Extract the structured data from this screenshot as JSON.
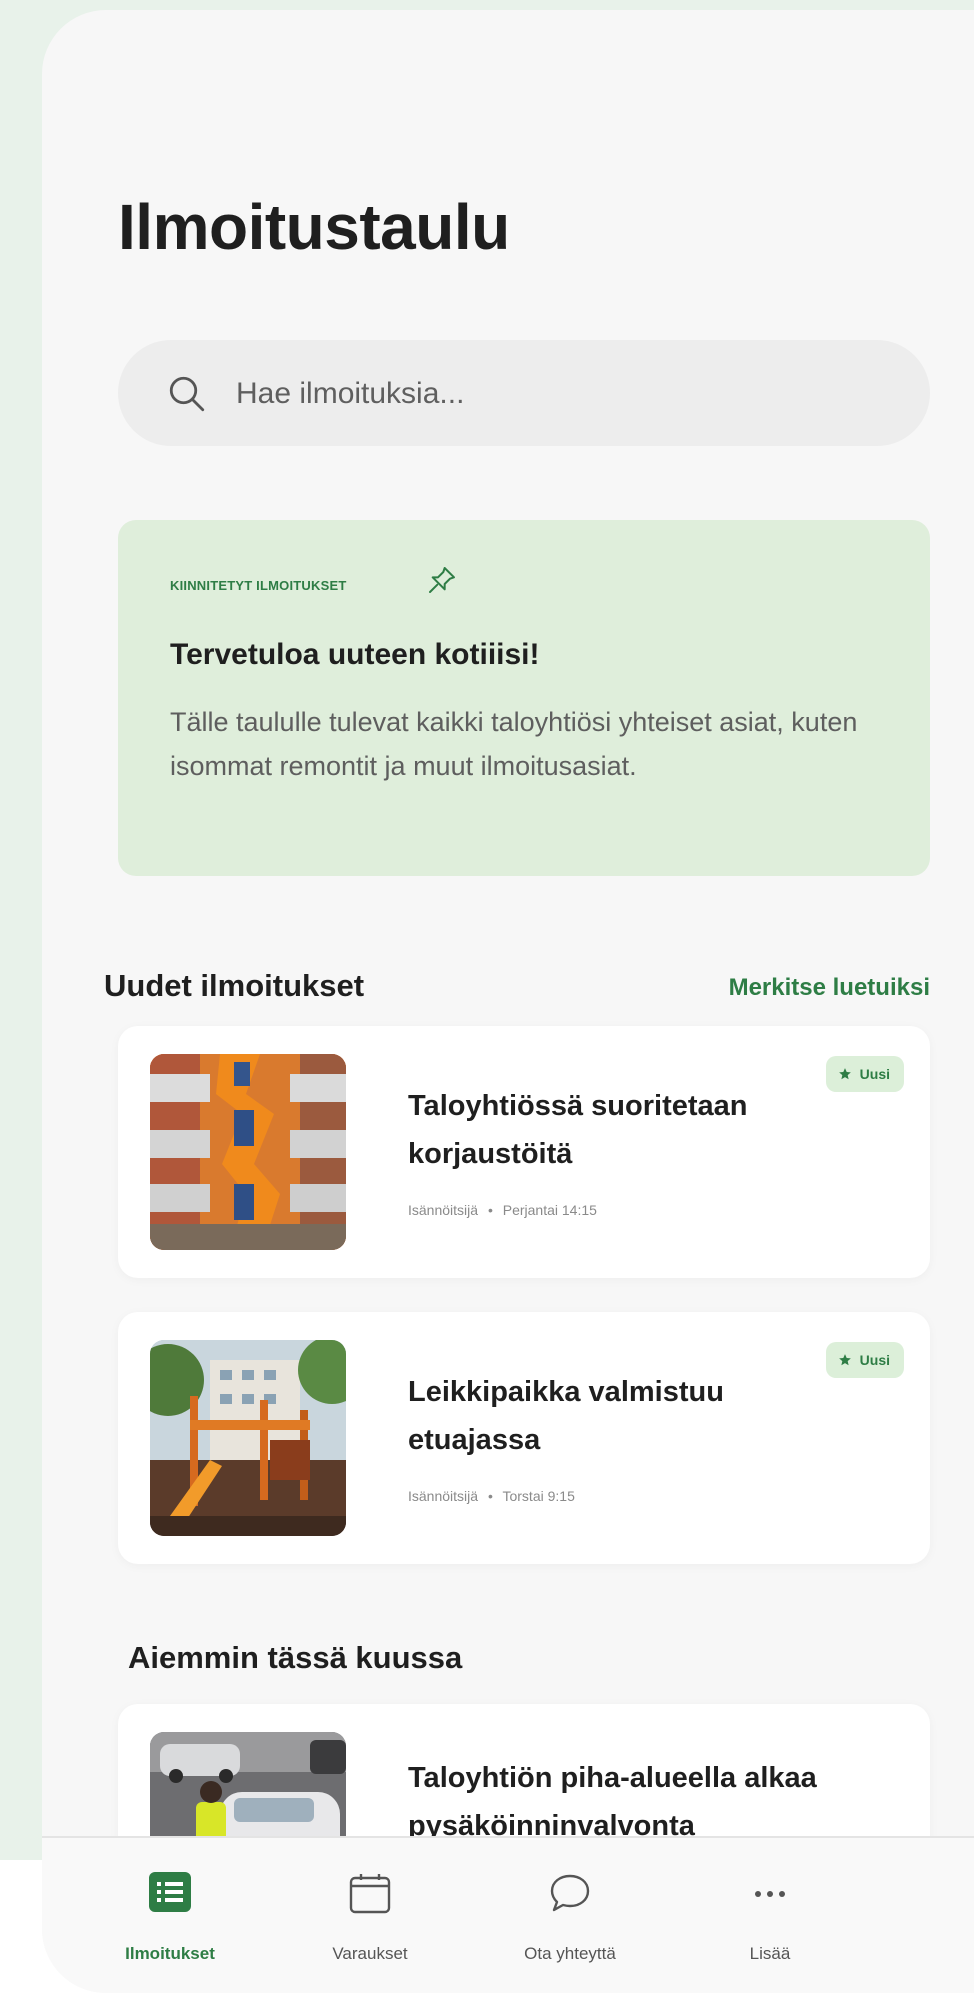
{
  "page": {
    "title": "Ilmoitustaulu"
  },
  "search": {
    "placeholder": "Hae ilmoituksia..."
  },
  "pinned": {
    "label": "KIINNITETYT ILMOITUKSET",
    "title": "Tervetuloa uuteen kotiiisi!",
    "body": "Tälle taululle tulevat kaikki taloyhtiösi yhteiset asiat, kuten isommat remontit ja muut ilmoitusasiat."
  },
  "new_section": {
    "heading": "Uudet ilmoitukset",
    "mark_read": "Merkitse luetuiksi",
    "items": [
      {
        "title": "Taloyhtiössä suoritetaan korjaustöitä",
        "author": "Isännöitsijä",
        "time": "Perjantai 14:15",
        "badge": "Uusi"
      },
      {
        "title": "Leikkipaikka valmistuu etuajassa",
        "author": "Isännöitsijä",
        "time": "Torstai 9:15",
        "badge": "Uusi"
      }
    ]
  },
  "earlier_section": {
    "heading": "Aiemmin tässä kuussa",
    "items": [
      {
        "title": "Taloyhtiön piha-alueella alkaa pysäköinninvalvonta"
      }
    ]
  },
  "meta_separator": "•",
  "nav": {
    "items": [
      {
        "label": "Ilmoitukset",
        "icon": "list-icon",
        "active": true
      },
      {
        "label": "Varaukset",
        "icon": "calendar-icon",
        "active": false
      },
      {
        "label": "Ota yhteyttä",
        "icon": "chat-icon",
        "active": false
      },
      {
        "label": "Lisää",
        "icon": "more-icon",
        "active": false
      }
    ]
  },
  "colors": {
    "accent": "#2e7d45",
    "pinned_bg": "#dfeedb",
    "page_bg": "#f7f7f7"
  }
}
